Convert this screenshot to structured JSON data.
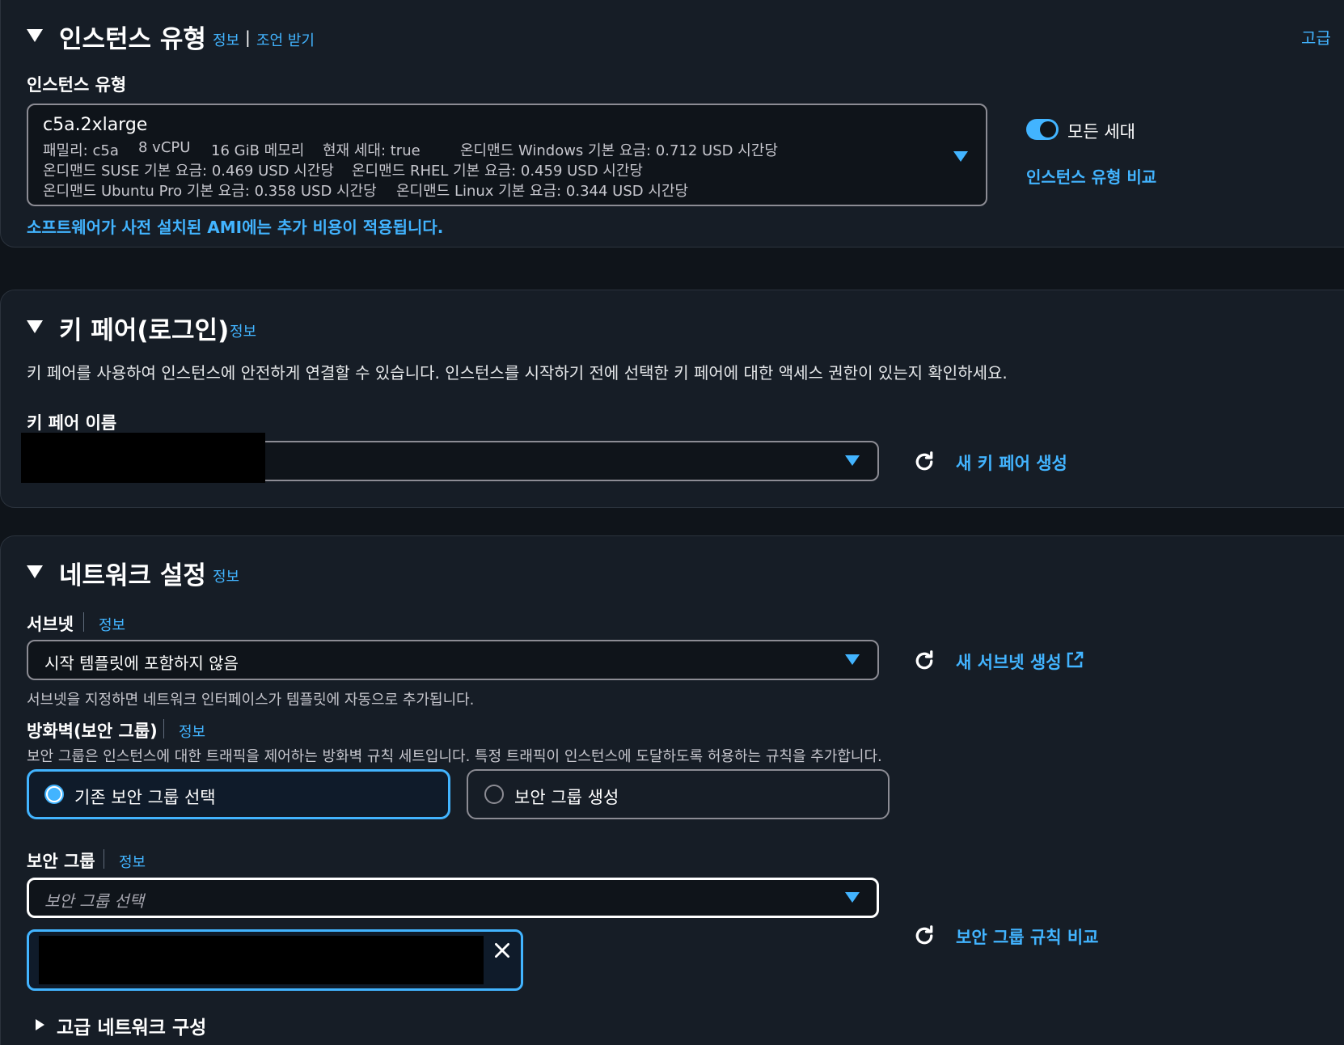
{
  "instance_type": {
    "title": "인스턴스 유형",
    "info": "정보",
    "divider": "|",
    "advice": "조언 받기",
    "advanced": "고급",
    "field_label": "인스턴스 유형",
    "selected": {
      "name": "c5a.2xlarge",
      "family": "패밀리: c5a",
      "vcpu": "8 vCPU",
      "memory": "16 GiB 메모리",
      "current_gen": "현재 세대: true",
      "windows_price": "온디맨드 Windows 기본 요금: 0.712 USD 시간당",
      "suse_price": "온디맨드 SUSE 기본 요금: 0.469 USD 시간당",
      "rhel_price": "온디맨드 RHEL 기본 요금: 0.459 USD 시간당",
      "ubuntu_price": "온디맨드 Ubuntu Pro 기본 요금: 0.358 USD 시간당",
      "linux_price": "온디맨드 Linux 기본 요금: 0.344 USD 시간당"
    },
    "toggle_label": "모든 세대",
    "toggle_on": true,
    "compare_link": "인스턴스 유형 비교",
    "ami_note": "소프트웨어가 사전 설치된 AMI에는 추가 비용이 적용됩니다."
  },
  "key_pair": {
    "title": "키 페어(로그인)",
    "info": "정보",
    "description": "키 페어를 사용하여 인스턴스에 안전하게 연결할 수 있습니다. 인스턴스를 시작하기 전에 선택한 키 페어에 대한 액세스 권한이 있는지 확인하세요.",
    "field_label": "키 페어 이름",
    "create_link": "새 키 페어 생성"
  },
  "network": {
    "title": "네트워크 설정",
    "info": "정보",
    "subnet_label": "서브넷",
    "subnet_info": "정보",
    "subnet_value": "시작 템플릿에 포함하지 않음",
    "subnet_help": "서브넷을 지정하면 네트워크 인터페이스가 템플릿에 자동으로 추가됩니다.",
    "create_subnet_link": "새 서브넷 생성",
    "firewall_label": "방화벽(보안 그룹)",
    "firewall_info": "정보",
    "firewall_desc": "보안 그룹은 인스턴스에 대한 트래픽을 제어하는 방화벽 규칙 세트입니다. 특정 트래픽이 인스턴스에 도달하도록 허용하는 규칙을 추가합니다.",
    "radio_existing": "기존 보안 그룹 선택",
    "radio_create": "보안 그룹 생성",
    "selected_radio": "existing",
    "sg_label": "보안 그룹",
    "sg_info": "정보",
    "sg_placeholder": "보안 그룹 선택",
    "compare_rules_link": "보안 그룹 규칙 비교",
    "advanced_network": "고급 네트워크 구성"
  },
  "colors": {
    "background": "#0f141a",
    "panel": "#161d26",
    "link": "#42b4ff",
    "selected_border": "#42b4ff",
    "selected_fill": "#0f1b2a",
    "border": "#8c8c94"
  }
}
